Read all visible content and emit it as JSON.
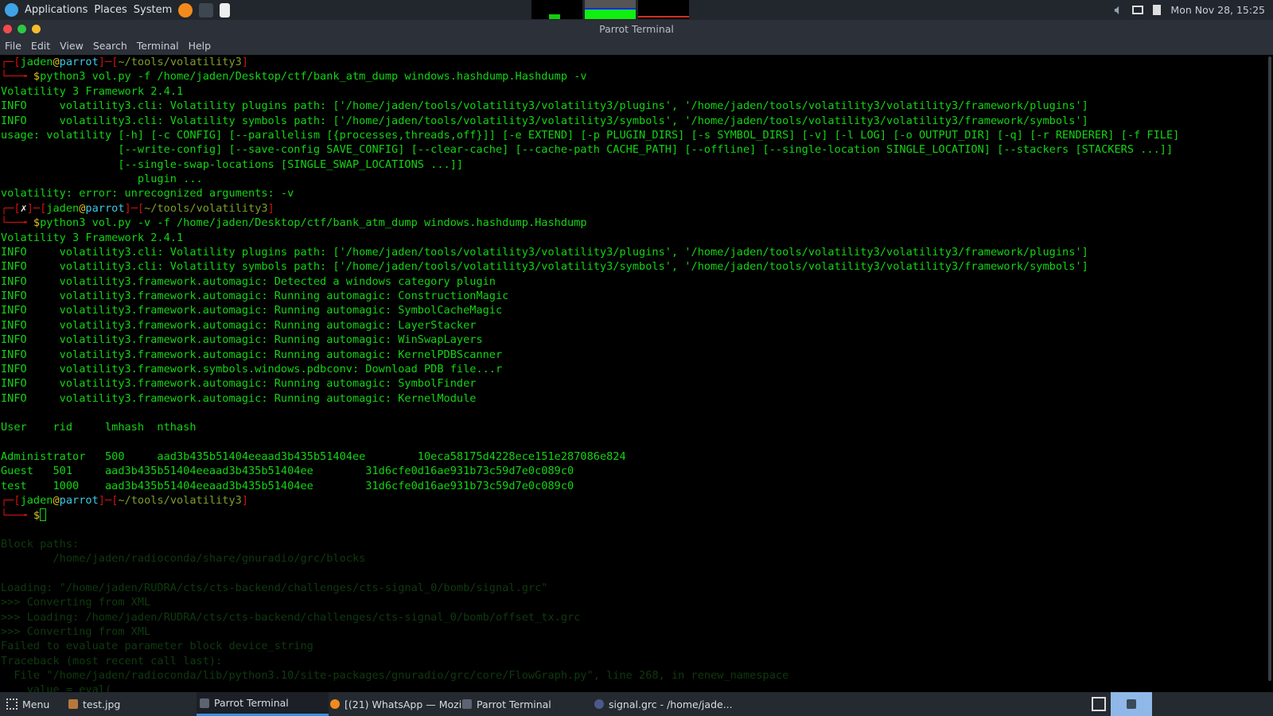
{
  "top_panel": {
    "menus": [
      "Applications",
      "Places",
      "System"
    ],
    "launchers": [
      "firefox-icon",
      "terminal-icon",
      "text-editor-icon"
    ],
    "clock": "Mon Nov 28, 15:25"
  },
  "window": {
    "title": "Parrot Terminal",
    "menu": [
      "File",
      "Edit",
      "View",
      "Search",
      "Terminal",
      "Help"
    ]
  },
  "terminal": {
    "lines": [
      [
        [
          "r",
          "┌─["
        ],
        [
          "g",
          "jaden"
        ],
        [
          "y",
          "@"
        ],
        [
          "c",
          "parrot"
        ],
        [
          "r",
          "]─["
        ],
        [
          "p",
          "~/tools/volatility3"
        ],
        [
          "r",
          "]"
        ]
      ],
      [
        [
          "r",
          "└──╼ "
        ],
        [
          "y",
          "$"
        ],
        [
          "g",
          "python3 vol.py -f /home/jaden/Desktop/ctf/bank_atm_dump windows.hashdump.Hashdump -v"
        ]
      ],
      [
        [
          "g",
          "Volatility 3 Framework 2.4.1"
        ]
      ],
      [
        [
          "g",
          "INFO     volatility3.cli: Volatility plugins path: ['/home/jaden/tools/volatility3/volatility3/plugins', '/home/jaden/tools/volatility3/volatility3/framework/plugins']"
        ]
      ],
      [
        [
          "g",
          "INFO     volatility3.cli: Volatility symbols path: ['/home/jaden/tools/volatility3/volatility3/symbols', '/home/jaden/tools/volatility3/volatility3/framework/symbols']"
        ]
      ],
      [
        [
          "g",
          "usage: volatility [-h] [-c CONFIG] [--parallelism [{processes,threads,off}]] [-e EXTEND] [-p PLUGIN_DIRS] [-s SYMBOL_DIRS] [-v] [-l LOG] [-o OUTPUT_DIR] [-q] [-r RENDERER] [-f FILE]"
        ]
      ],
      [
        [
          "g",
          "                  [--write-config] [--save-config SAVE_CONFIG] [--clear-cache] [--cache-path CACHE_PATH] [--offline] [--single-location SINGLE_LOCATION] [--stackers [STACKERS ...]]"
        ]
      ],
      [
        [
          "g",
          "                  [--single-swap-locations [SINGLE_SWAP_LOCATIONS ...]]"
        ]
      ],
      [
        [
          "g",
          "                     plugin ..."
        ]
      ],
      [
        [
          "g",
          "volatility: error: unrecognized arguments: -v"
        ]
      ],
      [
        [
          "r",
          "┌─["
        ],
        [
          "w",
          "✗"
        ],
        [
          "r",
          "]─["
        ],
        [
          "g",
          "jaden"
        ],
        [
          "y",
          "@"
        ],
        [
          "c",
          "parrot"
        ],
        [
          "r",
          "]─["
        ],
        [
          "p",
          "~/tools/volatility3"
        ],
        [
          "r",
          "]"
        ]
      ],
      [
        [
          "r",
          "└──╼ "
        ],
        [
          "y",
          "$"
        ],
        [
          "g",
          "python3 vol.py -v -f /home/jaden/Desktop/ctf/bank_atm_dump windows.hashdump.Hashdump"
        ]
      ],
      [
        [
          "g",
          "Volatility 3 Framework 2.4.1"
        ]
      ],
      [
        [
          "g",
          "INFO     volatility3.cli: Volatility plugins path: ['/home/jaden/tools/volatility3/volatility3/plugins', '/home/jaden/tools/volatility3/volatility3/framework/plugins']"
        ]
      ],
      [
        [
          "g",
          "INFO     volatility3.cli: Volatility symbols path: ['/home/jaden/tools/volatility3/volatility3/symbols', '/home/jaden/tools/volatility3/volatility3/framework/symbols']"
        ]
      ],
      [
        [
          "g",
          "INFO     volatility3.framework.automagic: Detected a windows category plugin"
        ]
      ],
      [
        [
          "g",
          "INFO     volatility3.framework.automagic: Running automagic: ConstructionMagic"
        ]
      ],
      [
        [
          "g",
          "INFO     volatility3.framework.automagic: Running automagic: SymbolCacheMagic"
        ]
      ],
      [
        [
          "g",
          "INFO     volatility3.framework.automagic: Running automagic: LayerStacker"
        ]
      ],
      [
        [
          "g",
          "INFO     volatility3.framework.automagic: Running automagic: WinSwapLayers"
        ]
      ],
      [
        [
          "g",
          "INFO     volatility3.framework.automagic: Running automagic: KernelPDBScanner"
        ]
      ],
      [
        [
          "g",
          "INFO     volatility3.framework.symbols.windows.pdbconv: Download PDB file...r"
        ]
      ],
      [
        [
          "g",
          "INFO     volatility3.framework.automagic: Running automagic: SymbolFinder"
        ]
      ],
      [
        [
          "g",
          "INFO     volatility3.framework.automagic: Running automagic: KernelModule"
        ]
      ],
      [
        [
          "g",
          ""
        ]
      ],
      [
        [
          "g",
          "User    rid     lmhash  nthash"
        ]
      ],
      [
        [
          "g",
          ""
        ]
      ],
      [
        [
          "g",
          "Administrator   500     aad3b435b51404eeaad3b435b51404ee        10eca58175d4228ece151e287086e824"
        ]
      ],
      [
        [
          "g",
          "Guest   501     aad3b435b51404eeaad3b435b51404ee        31d6cfe0d16ae931b73c59d7e0c089c0"
        ]
      ],
      [
        [
          "g",
          "test    1000    aad3b435b51404eeaad3b435b51404ee        31d6cfe0d16ae931b73c59d7e0c089c0"
        ]
      ],
      [
        [
          "r",
          "┌─["
        ],
        [
          "g",
          "jaden"
        ],
        [
          "y",
          "@"
        ],
        [
          "c",
          "parrot"
        ],
        [
          "r",
          "]─["
        ],
        [
          "p",
          "~/tools/volatility3"
        ],
        [
          "r",
          "]"
        ]
      ],
      [
        [
          "r",
          "└──╼ "
        ],
        [
          "y",
          "$"
        ]
      ]
    ],
    "ghost_lines": [
      "",
      "",
      "",
      "",
      "",
      "",
      "",
      "",
      "",
      "",
      "",
      "",
      "",
      "",
      "",
      "",
      "",
      "",
      "",
      "",
      "",
      "",
      "",
      "",
      "",
      "",
      "",
      "",
      "",
      "",
      "",
      "",
      "",
      "Block paths:",
      "        /home/jaden/radioconda/share/gnuradio/grc/blocks",
      "",
      "Loading: \"/home/jaden/RUDRA/cts/cts-backend/challenges/cts-signal_0/bomb/signal.grc\"",
      ">>> Converting from XML",
      ">>> Loading: /home/jaden/RUDRA/cts/cts-backend/challenges/cts-signal_0/bomb/offset_tx.grc",
      ">>> Converting from XML",
      "Failed to evaluate parameter block device_string",
      "Traceback (most recent call last):",
      "  File \"/home/jaden/radioconda/lib/python3.10/site-packages/gnuradio/grc/core/FlowGraph.py\", line 268, in renew_namespace",
      "    value = eval("
    ]
  },
  "taskbar": {
    "menu": "Menu",
    "tasks": [
      "test.jpg",
      "Parrot Terminal",
      "[(21) WhatsApp — Mozi...",
      "Parrot Terminal",
      "signal.grc - /home/jade..."
    ]
  },
  "colors": {
    "text": "#14d414",
    "prompt_bracket": "#d01010",
    "accent": "#3b8fe0"
  }
}
